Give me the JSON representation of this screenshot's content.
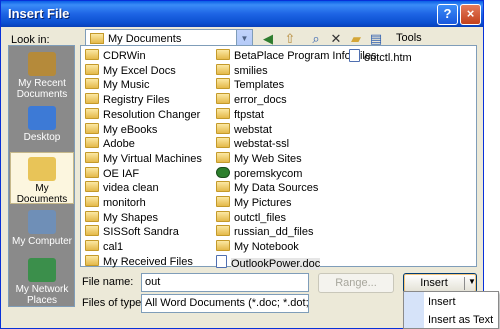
{
  "window": {
    "title": "Insert File",
    "help_glyph": "?",
    "close_glyph": "×"
  },
  "lookin": {
    "label": "Look in:",
    "value": "My Documents"
  },
  "toolbar": {
    "tools_label": "Tools"
  },
  "places": [
    {
      "label": "My Recent Documents",
      "icon": "recent-documents-icon",
      "color": "#b58a3a"
    },
    {
      "label": "Desktop",
      "icon": "desktop-icon",
      "color": "#3d7ad6"
    },
    {
      "label": "My Documents",
      "icon": "my-documents-icon",
      "color": "#e8c458"
    },
    {
      "label": "My Computer",
      "icon": "my-computer-icon",
      "color": "#6f8fb7"
    },
    {
      "label": "My Network Places",
      "icon": "network-places-icon",
      "color": "#3b8f4b"
    }
  ],
  "files_col1": [
    {
      "name": "CDRWin",
      "type": "folder"
    },
    {
      "name": "My Excel Docs",
      "type": "folder"
    },
    {
      "name": "My Music",
      "type": "folder"
    },
    {
      "name": "Registry Files",
      "type": "folder"
    },
    {
      "name": "Resolution Changer",
      "type": "folder"
    },
    {
      "name": "My eBooks",
      "type": "folder"
    },
    {
      "name": "Adobe",
      "type": "folder"
    },
    {
      "name": "My Virtual Machines",
      "type": "folder"
    },
    {
      "name": "OE IAF",
      "type": "folder"
    },
    {
      "name": "videa clean",
      "type": "folder"
    },
    {
      "name": "monitorh",
      "type": "folder"
    },
    {
      "name": "My Shapes",
      "type": "folder"
    },
    {
      "name": "SISSoft Sandra",
      "type": "folder"
    },
    {
      "name": "cal1",
      "type": "folder"
    },
    {
      "name": "My Received Files",
      "type": "folder"
    }
  ],
  "files_col2": [
    {
      "name": "BetaPlace Program Info_files",
      "type": "folder"
    },
    {
      "name": "smilies",
      "type": "folder"
    },
    {
      "name": "Templates",
      "type": "folder"
    },
    {
      "name": "error_docs",
      "type": "folder"
    },
    {
      "name": "ftpstat",
      "type": "folder"
    },
    {
      "name": "webstat",
      "type": "folder"
    },
    {
      "name": "webstat-ssl",
      "type": "folder"
    },
    {
      "name": "My Web Sites",
      "type": "folder"
    },
    {
      "name": "poremskycom",
      "type": "sys"
    },
    {
      "name": "My Data Sources",
      "type": "folder"
    },
    {
      "name": "My Pictures",
      "type": "folder"
    },
    {
      "name": "outctl_files",
      "type": "folder"
    },
    {
      "name": "russian_dd_files",
      "type": "folder"
    },
    {
      "name": "My Notebook",
      "type": "folder"
    },
    {
      "name": "OutlookPower.doc",
      "type": "doc"
    }
  ],
  "files_col3": [
    {
      "name": "outctl.htm",
      "type": "doc"
    }
  ],
  "form": {
    "filename_label": "File name:",
    "filename_value": "out",
    "filetype_label": "Files of type:",
    "filetype_value": "All Word Documents (*.doc; *.dot; *.htm",
    "range_label": "Range...",
    "insert_label": "Insert"
  },
  "menu": {
    "items": [
      "Insert",
      "Insert as Text"
    ]
  }
}
